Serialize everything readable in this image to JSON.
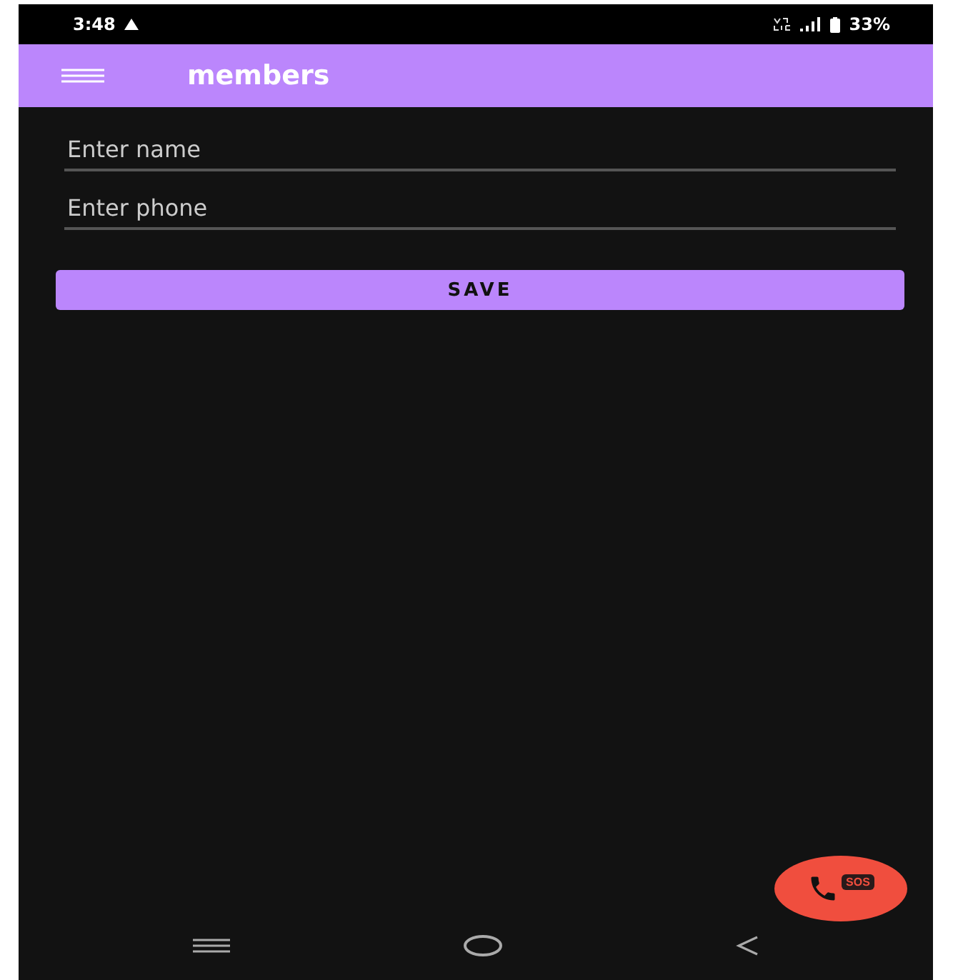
{
  "status_bar": {
    "time": "3:48",
    "battery": "33%"
  },
  "app_bar": {
    "title": "members"
  },
  "fields": [
    {
      "placeholder": "Enter name"
    },
    {
      "placeholder": "Enter phone"
    }
  ],
  "save_button": "SAVE",
  "fab": {
    "badge": "SOS"
  }
}
